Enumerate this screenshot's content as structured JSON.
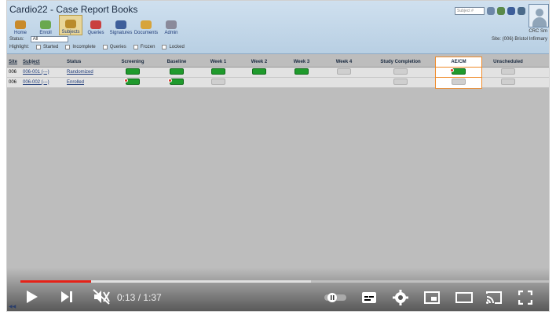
{
  "app": {
    "title": "Cardio22 - Case Report Books",
    "toolbar": [
      {
        "label": "Home",
        "color": "#c88a2b"
      },
      {
        "label": "Enroll",
        "color": "#6aa84f"
      },
      {
        "label": "Subjects",
        "color": "#b98b2b"
      },
      {
        "label": "Queries",
        "color": "#c94040"
      },
      {
        "label": "Signatures",
        "color": "#3d5e9a"
      },
      {
        "label": "Documents",
        "color": "#d7a43a"
      },
      {
        "label": "Admin",
        "color": "#8a8a9a"
      }
    ],
    "status_label": "Status:",
    "status_value": "All",
    "highlight_label": "Highlight:",
    "highlight_options": [
      "Started",
      "Incomplete",
      "Queries",
      "Frozen",
      "Locked"
    ],
    "subject_search_placeholder": "Subject #",
    "user_initials": "CRC Sm",
    "site_text": "Site: (006) Bristol Infirmary"
  },
  "grid": {
    "columns": [
      "Site",
      "Subject",
      "Status",
      "Screening",
      "Baseline",
      "Week 1",
      "Week 2",
      "Week 3",
      "Week 4",
      "Study Completion",
      "AE/CM",
      "Unscheduled"
    ],
    "rows": [
      {
        "site": "006",
        "subject": "006-001 (---)",
        "status": "Randomized",
        "cells": [
          "green",
          "green",
          "green",
          "green",
          "green",
          "gray",
          "gray",
          "green-flag",
          "gray"
        ]
      },
      {
        "site": "006",
        "subject": "006-002 (---)",
        "status": "Enrolled",
        "cells": [
          "green-flag",
          "green-flag",
          "gray",
          "none",
          "none",
          "none",
          "gray",
          "gray",
          "gray"
        ]
      }
    ],
    "highlighted_column": "AE/CM"
  },
  "video": {
    "time_current": "0:13",
    "time_total": "1:37",
    "time_display": "0:13 / 1:37",
    "played_fraction": 0.1333,
    "buffered_fraction": 0.55
  }
}
